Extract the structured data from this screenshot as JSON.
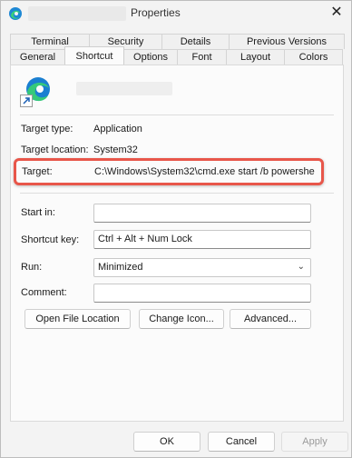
{
  "window": {
    "title": "Properties",
    "close_glyph": "✕"
  },
  "tabs": {
    "row1": [
      "Terminal",
      "Security",
      "Details",
      "Previous Versions"
    ],
    "row2": [
      "General",
      "Shortcut",
      "Options",
      "Font",
      "Layout",
      "Colors"
    ],
    "active": "Shortcut"
  },
  "shortcut": {
    "target_type_label": "Target type:",
    "target_type_value": "Application",
    "target_location_label": "Target location:",
    "target_location_value": "System32",
    "target_label": "Target:",
    "target_value": "C:\\Windows\\System32\\cmd.exe start /b powershe",
    "start_in_label": "Start in:",
    "start_in_value": "",
    "shortcut_key_label": "Shortcut key:",
    "shortcut_key_value": "Ctrl + Alt + Num Lock",
    "run_label": "Run:",
    "run_value": "Minimized",
    "comment_label": "Comment:",
    "comment_value": "",
    "open_file_location": "Open File Location",
    "change_icon": "Change Icon...",
    "advanced": "Advanced..."
  },
  "dialog_buttons": {
    "ok": "OK",
    "cancel": "Cancel",
    "apply": "Apply"
  },
  "colors": {
    "highlight": "#e8564a"
  },
  "icons": {
    "app": "edge-icon",
    "shortcut_overlay": "shortcut-arrow-icon"
  }
}
